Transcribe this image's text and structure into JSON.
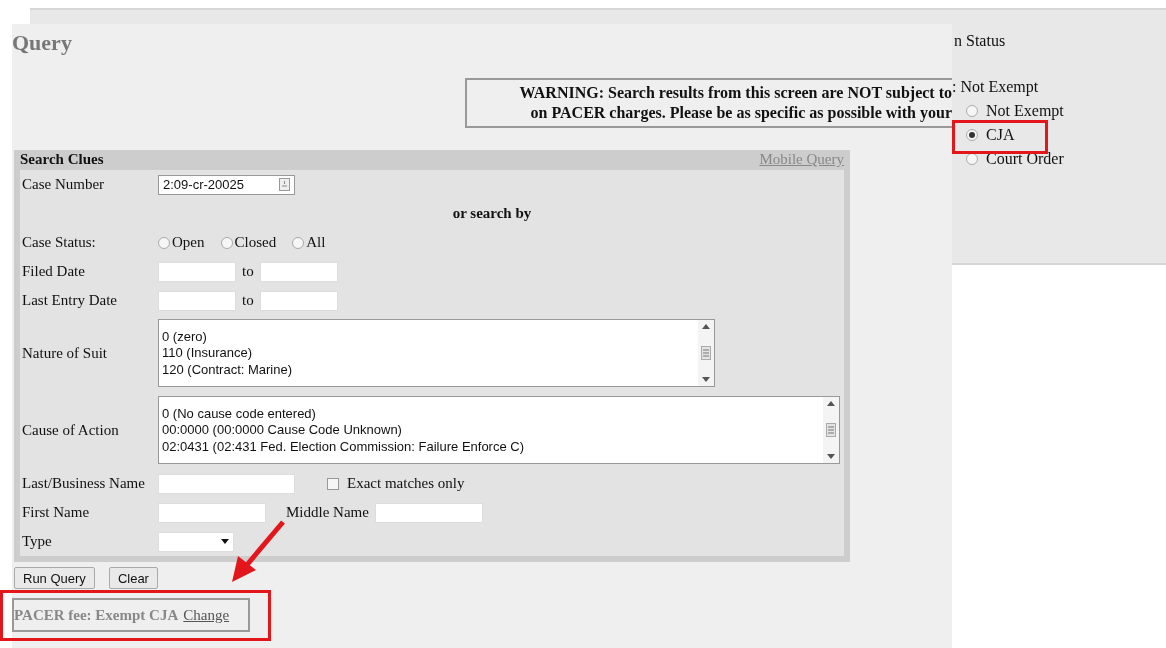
{
  "background_window": {
    "heading": "n Status",
    "current": ": Not Exempt",
    "options": [
      {
        "label": "Not Exempt",
        "selected": false
      },
      {
        "label": "CJA",
        "selected": true
      },
      {
        "label": "Court Order",
        "selected": false
      }
    ]
  },
  "page": {
    "title": "Query",
    "warning": [
      "WARNING: Search results from this screen are NOT subject to",
      "on PACER charges. Please be as specific as possible with your"
    ]
  },
  "search_clues": {
    "title": "Search Clues",
    "mobile_link": "Mobile Query",
    "case_number": {
      "label": "Case Number",
      "value": "2:09-cr-20025"
    },
    "or_search_by": "or search by",
    "case_status": {
      "label": "Case Status:",
      "options": [
        {
          "label": "Open",
          "selected": false
        },
        {
          "label": "Closed",
          "selected": false
        },
        {
          "label": "All",
          "selected": false
        }
      ]
    },
    "filed_date": {
      "label": "Filed Date",
      "to": "to"
    },
    "last_entry_date": {
      "label": "Last Entry Date",
      "to": "to"
    },
    "nature_of_suit": {
      "label": "Nature of Suit",
      "items": [
        "0 (zero)",
        "110 (Insurance)",
        "120 (Contract: Marine)"
      ]
    },
    "cause_of_action": {
      "label": "Cause of Action",
      "items": [
        "0 (No cause code entered)",
        "00:0000 (00:0000 Cause Code Unknown)",
        "02:0431 (02:431 Fed. Election Commission: Failure Enforce C)"
      ]
    },
    "last_business_name": {
      "label": "Last/Business Name",
      "exact_matches": {
        "label": "Exact matches only",
        "checked": false
      }
    },
    "first_name": {
      "label": "First Name"
    },
    "middle_name": {
      "label": "Middle Name"
    },
    "type": {
      "label": "Type"
    }
  },
  "buttons": [
    "Run Query",
    "Clear"
  ],
  "fee": {
    "text": "PACER fee: Exempt CJA",
    "link": "Change"
  }
}
